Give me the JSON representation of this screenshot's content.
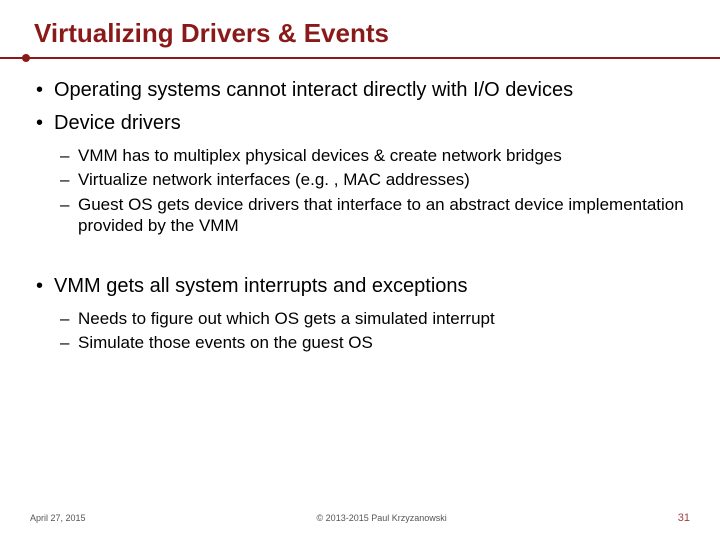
{
  "title": "Virtualizing Drivers & Events",
  "bullets": {
    "b1_0": "Operating systems cannot interact directly with I/O devices",
    "b1_1": "Device drivers",
    "b2_0": "VMM has to multiplex physical devices & create network bridges",
    "b2_1": "Virtualize network interfaces (e.g. , MAC addresses)",
    "b2_2": "Guest OS gets device drivers that interface to an abstract device implementation provided by the VMM",
    "b1_2": "VMM gets all system interrupts and exceptions",
    "b2_3": "Needs to figure out which OS gets a simulated interrupt",
    "b2_4": "Simulate those events on the guest OS"
  },
  "footer": {
    "date": "April 27, 2015",
    "copyright": "© 2013-2015 Paul Krzyzanowski",
    "page": "31"
  }
}
